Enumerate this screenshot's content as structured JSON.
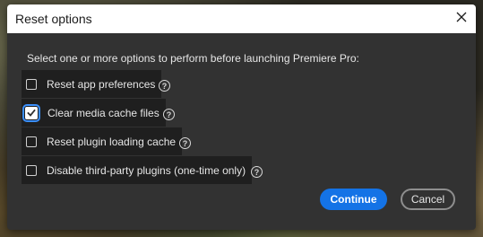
{
  "dialog": {
    "title": "Reset options",
    "close_icon": "close-icon",
    "prompt": "Select one or more options to perform before launching Premiere Pro:",
    "options": [
      {
        "label": "Reset app preferences",
        "checked": false,
        "help_icon": "help-icon"
      },
      {
        "label": "Clear media cache files",
        "checked": true,
        "help_icon": "help-icon"
      },
      {
        "label": "Reset plugin loading cache",
        "checked": false,
        "help_icon": "help-icon"
      },
      {
        "label": "Disable third-party plugins (one-time only)",
        "checked": false,
        "help_icon": "help-icon"
      }
    ],
    "help_glyph": "?",
    "buttons": {
      "continue_label": "Continue",
      "cancel_label": "Cancel"
    }
  },
  "colors": {
    "accent": "#1473e6",
    "dialog_bg": "#323232",
    "row_bg": "#1f1f1f",
    "titlebar_bg": "#ffffff",
    "focus_ring": "#3b8ffa"
  }
}
